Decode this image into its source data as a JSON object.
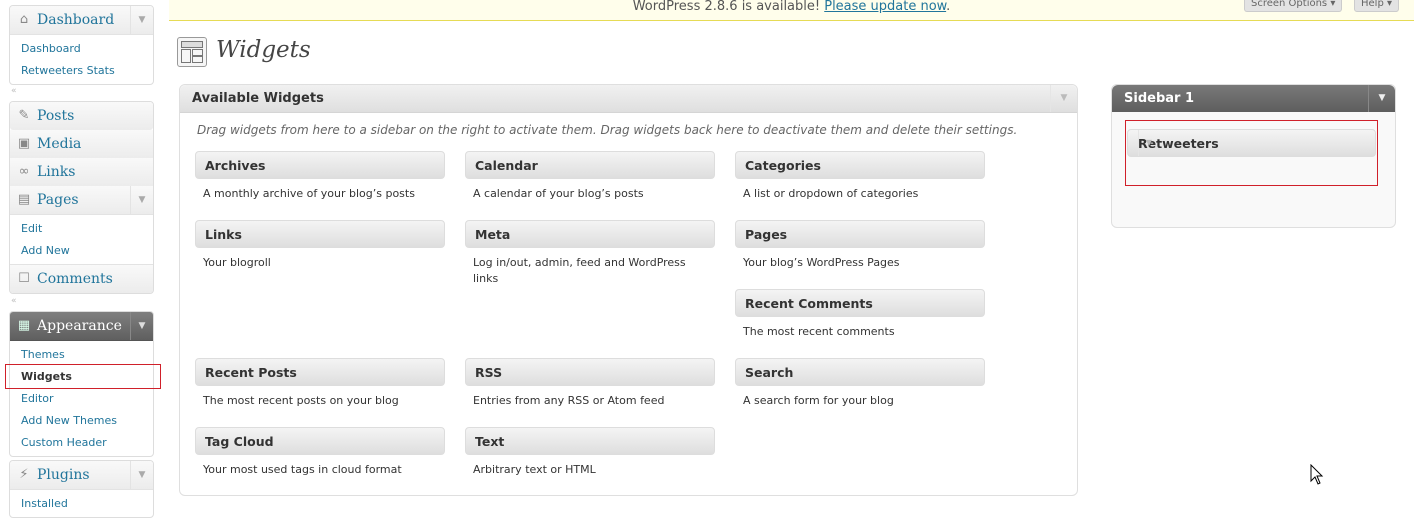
{
  "menu": {
    "dashboard": {
      "label": "Dashboard",
      "icon": "home-icon",
      "items": [
        "Dashboard",
        "Retweeters Stats"
      ]
    },
    "posts": {
      "label": "Posts",
      "icon": "pushpin-icon"
    },
    "media": {
      "label": "Media",
      "icon": "media-icon"
    },
    "links": {
      "label": "Links",
      "icon": "link-icon"
    },
    "pages": {
      "label": "Pages",
      "icon": "pages-icon",
      "items": [
        "Edit",
        "Add New"
      ]
    },
    "comments": {
      "label": "Comments",
      "icon": "comment-icon"
    },
    "appearance": {
      "label": "Appearance",
      "icon": "appearance-icon",
      "items": [
        "Themes",
        "Widgets",
        "Editor",
        "Add New Themes",
        "Custom Header"
      ]
    },
    "plugins": {
      "label": "Plugins",
      "icon": "plugin-icon",
      "items": [
        "Installed"
      ]
    }
  },
  "update_nag": {
    "text": "WordPress 2.8.6 is available! ",
    "link": "Please update now",
    "suffix": "."
  },
  "screen_meta": {
    "screen_options": "Screen Options ▾",
    "help": "Help ▾"
  },
  "page": {
    "title": "Widgets"
  },
  "available": {
    "title": "Available Widgets",
    "description": "Drag widgets from here to a sidebar on the right to activate them. Drag widgets back here to deactivate them and delete their settings.",
    "widgets": [
      {
        "title": "Archives",
        "desc": "A monthly archive of your blog’s posts"
      },
      {
        "title": "Calendar",
        "desc": "A calendar of your blog’s posts"
      },
      {
        "title": "Categories",
        "desc": "A list or dropdown of categories"
      },
      {
        "title": "Links",
        "desc": "Your blogroll"
      },
      {
        "title": "Meta",
        "desc": "Log in/out, admin, feed and WordPress links"
      },
      {
        "title": "Pages",
        "desc": "Your blog’s WordPress Pages"
      },
      {
        "title": "Recent Comments",
        "desc": "The most recent comments"
      },
      {
        "title": "Recent Posts",
        "desc": "The most recent posts on your blog"
      },
      {
        "title": "RSS",
        "desc": "Entries from any RSS or Atom feed"
      },
      {
        "title": "Search",
        "desc": "A search form for your blog"
      },
      {
        "title": "Tag Cloud",
        "desc": "Your most used tags in cloud format"
      },
      {
        "title": "Text",
        "desc": "Arbitrary text or HTML"
      }
    ]
  },
  "sidebar": {
    "title": "Sidebar 1",
    "widgets": [
      {
        "title": "Retweeters"
      }
    ]
  },
  "colors": {
    "link": "#21759b",
    "highlight": "#d0202a",
    "nag_bg": "#fffeeb"
  }
}
